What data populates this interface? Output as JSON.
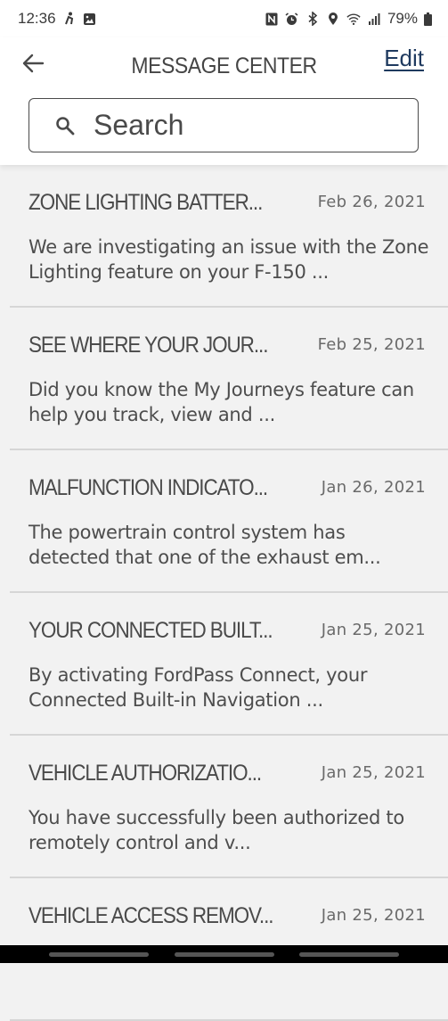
{
  "status_bar": {
    "time": "12:36",
    "left_icons": [
      "accessibility-icon",
      "gallery-icon"
    ],
    "right_icons": [
      "nfc-icon",
      "alarm-icon",
      "bluetooth-icon",
      "location-icon",
      "wifi-icon",
      "signal-icon"
    ],
    "battery": "79%"
  },
  "header": {
    "back_icon": "arrow-left-icon",
    "title": "MESSAGE CENTER",
    "edit_label": "Edit"
  },
  "search": {
    "icon": "search-icon",
    "placeholder": "Search",
    "value": ""
  },
  "messages": [
    {
      "title": "ZONE LIGHTING BATTER...",
      "date": "Feb 26, 2021",
      "body": "We are investigating an issue with the Zone Lighting feature on your F-150 ..."
    },
    {
      "title": "SEE WHERE YOUR JOUR...",
      "date": "Feb 25, 2021",
      "body": "Did you know the My Journeys feature can help you track, view and ..."
    },
    {
      "title": "MALFUNCTION INDICATO...",
      "date": "Jan 26, 2021",
      "body": "The powertrain control system has detected that one of the exhaust em..."
    },
    {
      "title": "YOUR CONNECTED BUILT...",
      "date": "Jan 25, 2021",
      "body": "By activating FordPass Connect, your Connected Built-in Navigation ..."
    },
    {
      "title": "VEHICLE AUTHORIZATIO...",
      "date": "Jan 25, 2021",
      "body": "You have successfully been authorized to remotely control and v..."
    },
    {
      "title": "VEHICLE ACCESS REMOV...",
      "date": "Jan 25, 2021",
      "body": ""
    }
  ],
  "colors": {
    "edit_link": "#1f3a5f",
    "list_background": "#f2f2f2",
    "header_background": "#ffffff"
  }
}
